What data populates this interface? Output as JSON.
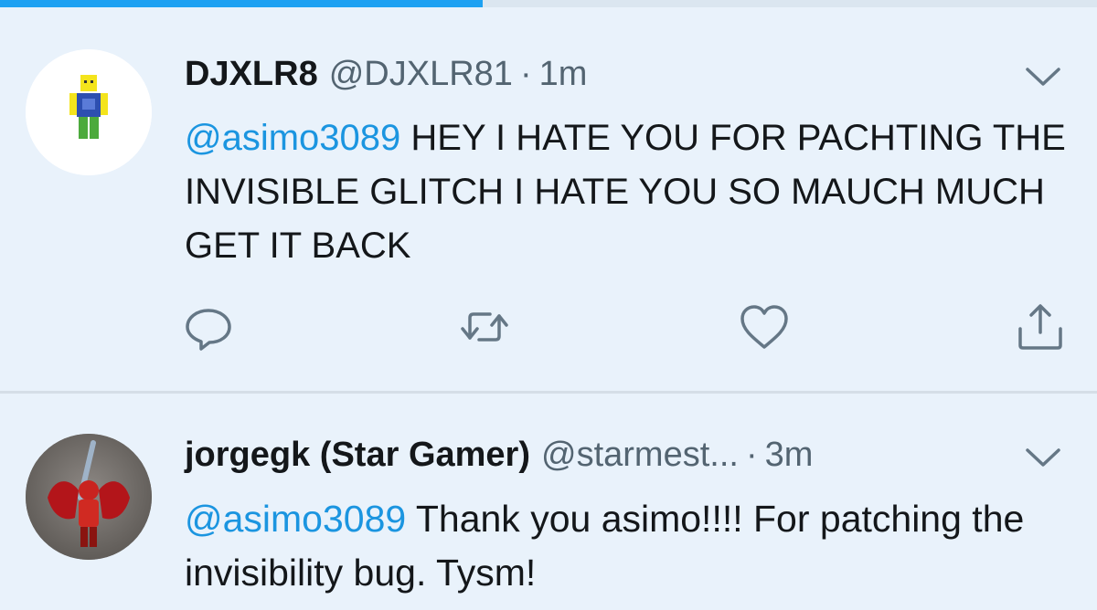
{
  "progress": {
    "fraction": 0.44,
    "color": "#1da1f2"
  },
  "colors": {
    "background": "#e9f2fb",
    "link": "#1b95e0",
    "text": "#14171a",
    "muted": "#536471",
    "icon": "#657786"
  },
  "tweets": [
    {
      "display_name": "DJXLR8",
      "handle": "@DJXLR81",
      "separator": "·",
      "time": "1m",
      "mention": "@asimo3089",
      "text": " HEY I HATE YOU FOR PACHTING THE INVISIBLE GLITCH I HATE YOU SO MAUCH MUCH GET IT BACK",
      "avatar_icon": "roblox-character-avatar",
      "menu_icon": "chevron-down-icon",
      "actions": [
        "reply-icon",
        "retweet-icon",
        "like-icon",
        "share-icon"
      ]
    },
    {
      "display_name": "jorgegk (Star Gamer)",
      "handle": "@starmest...",
      "separator": "·",
      "time": "3m",
      "mention": "@asimo3089",
      "text": " Thank you asimo!!!! For patching the invisibility bug. Tysm!",
      "avatar_icon": "winged-knight-avatar",
      "menu_icon": "chevron-down-icon"
    }
  ]
}
